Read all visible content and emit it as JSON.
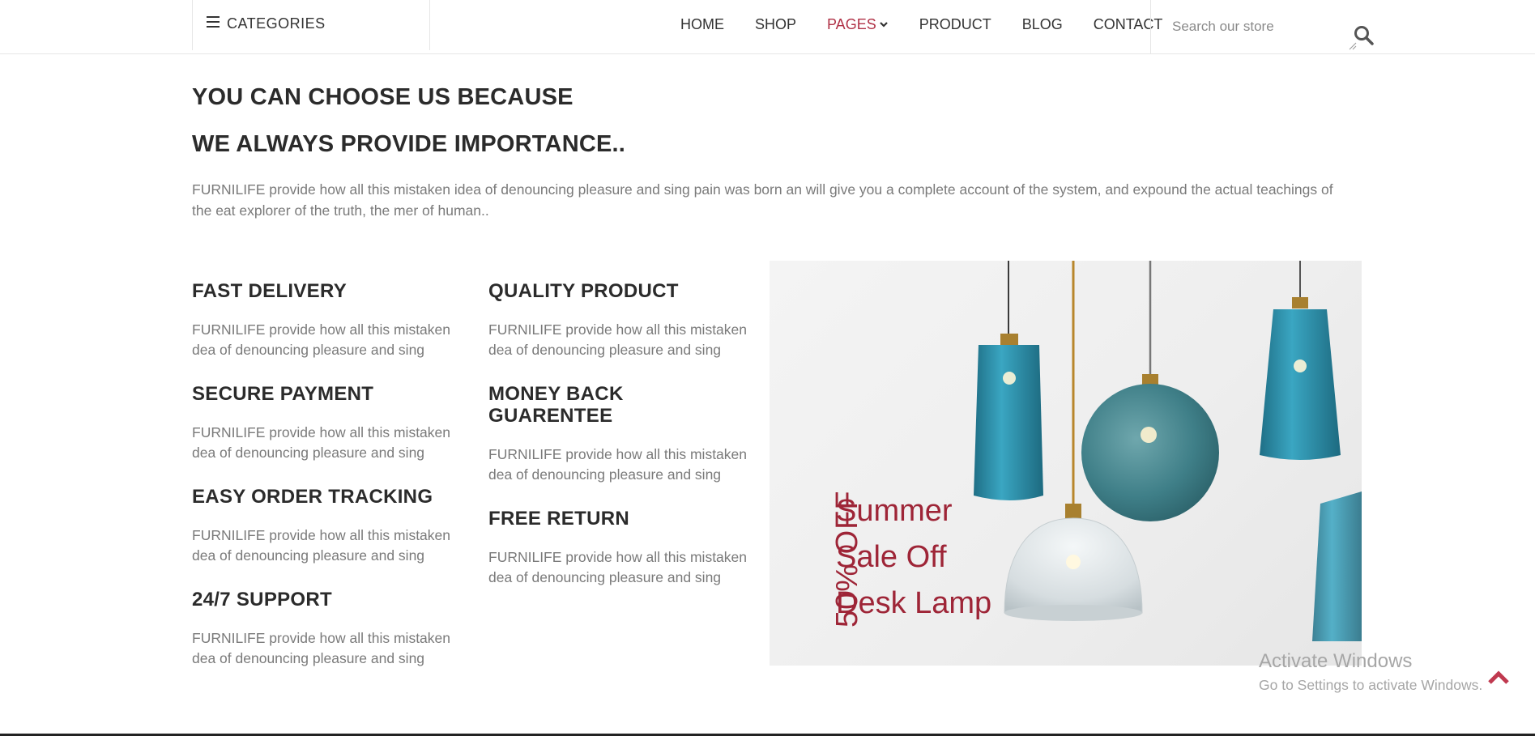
{
  "header": {
    "categories_label": "CATEGORIES",
    "nav": [
      {
        "label": "HOME"
      },
      {
        "label": "SHOP"
      },
      {
        "label": "PAGES"
      },
      {
        "label": "PRODUCT"
      },
      {
        "label": "BLOG"
      },
      {
        "label": "CONTACT"
      }
    ],
    "active_nav": "PAGES",
    "search_placeholder": "Search our store"
  },
  "intro": {
    "heading_1": "YOU CAN CHOOSE US BECAUSE",
    "heading_2": "WE ALWAYS PROVIDE IMPORTANCE..",
    "text": "FURNILIFE provide how all this mistaken idea of denouncing pleasure and sing pain was born an will give you a complete account of the system, and expound the actual teachings of the eat explorer of the truth, the mer of human.."
  },
  "features": [
    {
      "title": "FAST DELIVERY",
      "text": "FURNILIFE provide how all this mistaken dea of denouncing pleasure and sing"
    },
    {
      "title": "SECURE PAYMENT",
      "text": "FURNILIFE provide how all this mistaken dea of denouncing pleasure and sing"
    },
    {
      "title": "EASY ORDER TRACKING",
      "text": "FURNILIFE provide how all this mistaken dea of denouncing pleasure and sing"
    },
    {
      "title": "24/7 SUPPORT",
      "text": "FURNILIFE provide how all this mistaken dea of denouncing pleasure and sing"
    },
    {
      "title": "QUALITY PRODUCT",
      "text": "FURNILIFE provide how all this mistaken dea of denouncing pleasure and sing"
    },
    {
      "title": "MONEY BACK GUARENTEE",
      "text": "FURNILIFE provide how all this mistaken dea of denouncing pleasure and sing"
    },
    {
      "title": "FREE RETURN",
      "text": "FURNILIFE provide how all this mistaken dea of denouncing pleasure and sing"
    }
  ],
  "promo": {
    "discount": "50% OFF",
    "line_1": "Summer",
    "line_2": "Sale Off",
    "line_3": "Desk Lamp"
  },
  "windows_overlay": {
    "title": "Activate Windows",
    "subtitle": "Go to Settings to activate Windows."
  },
  "colors": {
    "accent": "#b03247",
    "promo": "#9e2537",
    "heading": "#2b2b2b",
    "body_text": "#7a7a7a",
    "lamp_teal": "#2f8fa8"
  },
  "icons": [
    "menu-icon",
    "chevron-down-icon",
    "search-icon",
    "scroll-to-top-icon"
  ]
}
